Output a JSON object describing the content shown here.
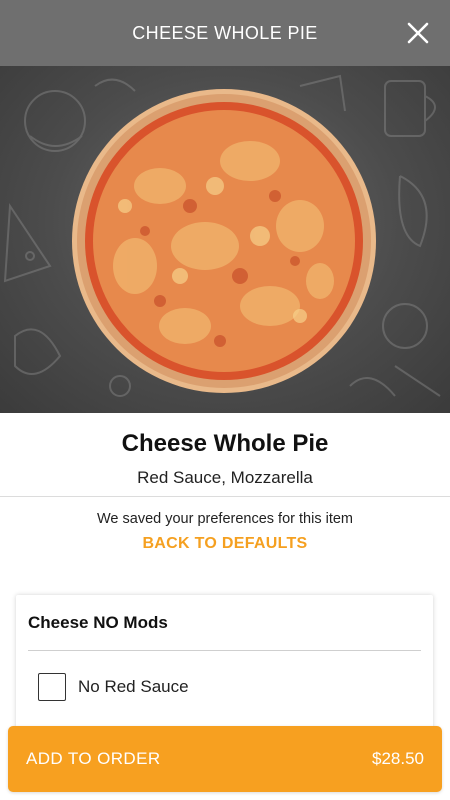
{
  "header": {
    "title": "CHEESE WHOLE PIE",
    "close_icon": "close-icon"
  },
  "hero": {
    "image_subject": "cheese-pizza",
    "background_color": "#4c4c4c"
  },
  "item": {
    "name": "Cheese Whole Pie",
    "description": "Red Sauce, Mozzarella"
  },
  "preferences": {
    "note": "We saved your preferences for this item",
    "back_to_defaults": "BACK TO DEFAULTS",
    "accent_color": "#f5a020"
  },
  "modifiers": {
    "group_title": "Cheese NO Mods",
    "options": [
      {
        "label": "No Red Sauce",
        "checked": false
      }
    ]
  },
  "footer": {
    "add_label": "ADD TO ORDER",
    "price": "$28.50",
    "button_color": "#f7a020"
  }
}
